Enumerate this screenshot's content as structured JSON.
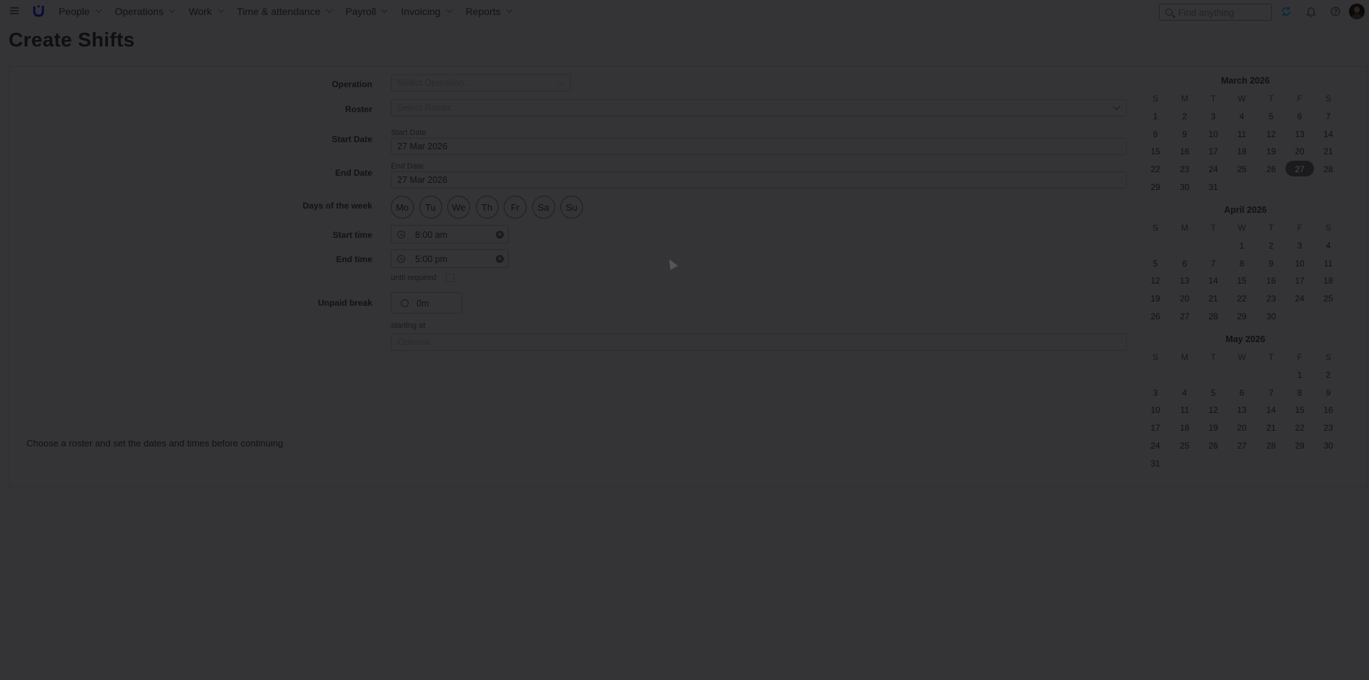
{
  "nav": {
    "menu_icon": "hamburger-icon",
    "logo_icon": "brand-logo-icon",
    "items": [
      "People",
      "Operations",
      "Work",
      "Time & attendance",
      "Payroll",
      "Invoicing",
      "Reports"
    ],
    "search_placeholder": "Find anything",
    "icons": [
      "sync-icon",
      "bell-icon",
      "help-icon"
    ]
  },
  "page_title": "Create Shifts",
  "form": {
    "operation_label": "Operation",
    "operation_placeholder": "Select Operation...",
    "roster_label": "Roster",
    "roster_placeholder": "Select Roster...",
    "start_date_label": "Start Date",
    "start_date_field_label": "Start Date",
    "start_date_value": "27 Mar 2026",
    "end_date_label": "End Date",
    "end_date_field_label": "End Date",
    "end_date_value": "27 Mar 2026",
    "days_label": "Days of the week",
    "days": [
      "Mo",
      "Tu",
      "We",
      "Th",
      "Fr",
      "Sa",
      "Su"
    ],
    "start_time_label": "Start time",
    "start_time_value": "8:00 am",
    "end_time_label": "End time",
    "end_time_value": "5:00 pm",
    "until_required_label": "until required",
    "unpaid_break_label": "Unpaid break",
    "unpaid_break_value": "0m",
    "starting_at_label": "starting at",
    "starting_at_placeholder": "Optional"
  },
  "hint": "Choose a roster and set the dates and times before continuing",
  "calendar": {
    "weekday_headers": [
      "S",
      "M",
      "T",
      "W",
      "T",
      "F",
      "S"
    ],
    "selected": "27",
    "months": [
      {
        "title": "March 2026",
        "weeks": [
          [
            "1",
            "2",
            "3",
            "4",
            "5",
            "6",
            "7"
          ],
          [
            "8",
            "9",
            "10",
            "11",
            "12",
            "13",
            "14"
          ],
          [
            "15",
            "16",
            "17",
            "18",
            "19",
            "20",
            "21"
          ],
          [
            "22",
            "23",
            "24",
            "25",
            "26",
            "27",
            "28"
          ],
          [
            "29",
            "30",
            "31",
            "",
            "",
            "",
            ""
          ]
        ]
      },
      {
        "title": "April 2026",
        "weeks": [
          [
            "",
            "",
            "",
            "1",
            "2",
            "3",
            "4"
          ],
          [
            "5",
            "6",
            "7",
            "8",
            "9",
            "10",
            "11"
          ],
          [
            "12",
            "13",
            "14",
            "15",
            "16",
            "17",
            "18"
          ],
          [
            "19",
            "20",
            "21",
            "22",
            "23",
            "24",
            "25"
          ],
          [
            "26",
            "27",
            "28",
            "29",
            "30",
            "",
            ""
          ]
        ]
      },
      {
        "title": "May 2026",
        "weeks": [
          [
            "",
            "",
            "",
            "",
            "",
            "1",
            "2"
          ],
          [
            "3",
            "4",
            "5",
            "6",
            "7",
            "8",
            "9"
          ],
          [
            "10",
            "11",
            "12",
            "13",
            "14",
            "15",
            "16"
          ],
          [
            "17",
            "18",
            "19",
            "20",
            "21",
            "22",
            "23"
          ],
          [
            "24",
            "25",
            "26",
            "27",
            "28",
            "29",
            "30"
          ],
          [
            "31",
            "",
            "",
            "",
            "",
            "",
            ""
          ]
        ]
      }
    ]
  }
}
